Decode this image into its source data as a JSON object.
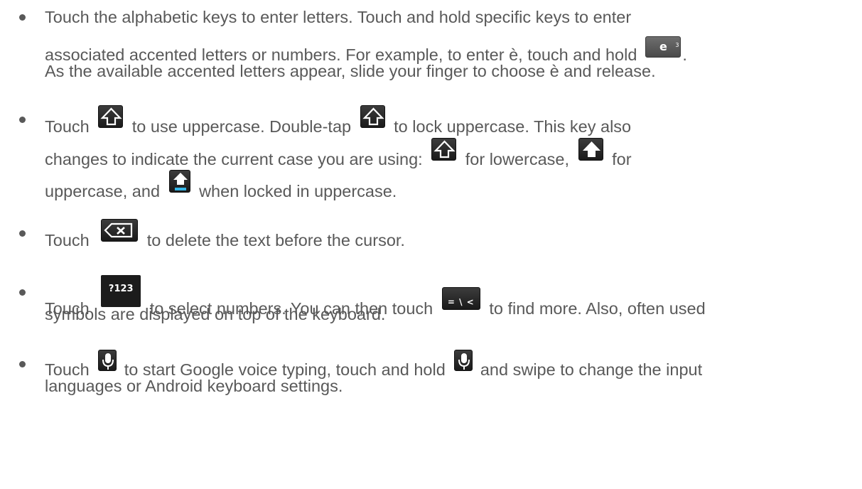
{
  "bullets": [
    {
      "lines": [
        {
          "a": "Touch the alphabetic keys to enter letters. Touch and hold specific keys to enter"
        },
        {
          "a": "associated accented letters or numbers. For example, to enter è, touch and hold",
          "b": "."
        },
        {
          "a": "As the available accented letters appear, slide your finger to choose è and release."
        }
      ],
      "key": {
        "main": "e",
        "sup": "3"
      }
    },
    {
      "lines": [
        {
          "a": "Touch",
          "b": "to use uppercase. Double-tap",
          "c": "to lock uppercase. This key also"
        },
        {
          "a": "changes to indicate the current case you are using:",
          "b": "for lowercase,",
          "c": "for"
        },
        {
          "a": "uppercase, and",
          "b": "when locked in uppercase."
        }
      ]
    },
    {
      "lines": [
        {
          "a": "Touch",
          "b": "to delete the text before the cursor."
        }
      ]
    },
    {
      "lines": [
        {
          "a": "Touch",
          "b": "to select numbers. You can then touch",
          "c": "to find more. Also, often used"
        },
        {
          "a": "symbols are displayed on top of the keyboard."
        }
      ],
      "key_sym": "?123",
      "key_eq": "= \\ <"
    },
    {
      "lines": [
        {
          "a": "Touch",
          "b": "to start Google voice typing, touch and hold",
          "c": "and swipe to change the input"
        },
        {
          "a": "languages or Android keyboard settings."
        }
      ]
    }
  ],
  "icons": {
    "shift_outline": "shift-outline-icon",
    "shift_filled": "shift-filled-icon",
    "shift_locked": "shift-locked-icon",
    "delete": "delete-icon",
    "mic": "microphone-icon"
  },
  "colors": {
    "text": "#595959",
    "key_bg": "#1c1c1c",
    "lock_bar": "#33b5e5"
  }
}
